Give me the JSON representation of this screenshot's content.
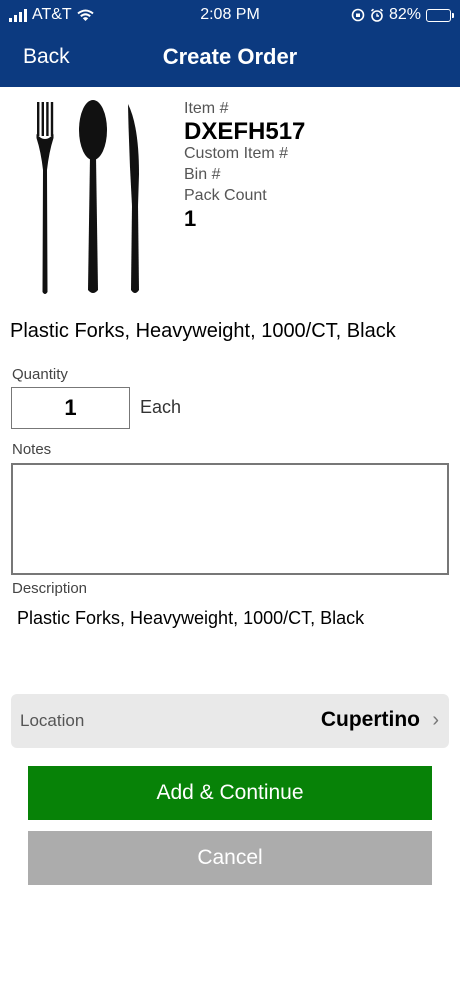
{
  "status_bar": {
    "carrier": "AT&T",
    "time": "2:08 PM",
    "battery": "82%",
    "battery_level": 0.82,
    "icons": [
      "signal-icon",
      "wifi-icon",
      "rotation-lock-icon",
      "alarm-icon",
      "battery-icon"
    ]
  },
  "nav": {
    "back_label": "Back",
    "title": "Create Order"
  },
  "product": {
    "image": "plastic-cutlery-image",
    "item_label": "Item #",
    "item_number": "DXEFH517",
    "custom_item_label": "Custom Item #",
    "bin_label": "Bin #",
    "pack_count_label": "Pack Count",
    "pack_count": "1",
    "name": "Plastic Forks, Heavyweight, 1000/CT, Black"
  },
  "form": {
    "quantity_label": "Quantity",
    "quantity_value": "1",
    "unit": "Each",
    "notes_label": "Notes",
    "notes_value": "",
    "description_label": "Description",
    "description_value": "Plastic Forks, Heavyweight, 1000/CT, Black"
  },
  "location": {
    "label": "Location",
    "value": "Cupertino"
  },
  "actions": {
    "add_label": "Add & Continue",
    "cancel_label": "Cancel"
  },
  "colors": {
    "header": "#0c3a80",
    "add_button": "#078207",
    "cancel_button": "#acacac"
  }
}
